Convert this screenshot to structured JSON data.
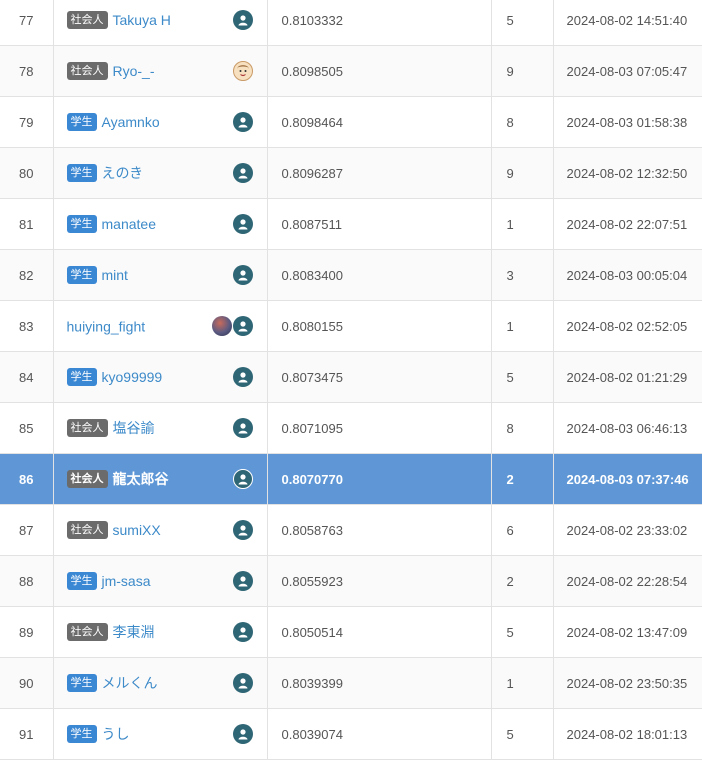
{
  "leaderboard": {
    "rows": [
      {
        "rank": "77",
        "badge": "社会人",
        "badge_color": "#6b6b6b",
        "name": "Takuya H",
        "avatars": [
          "default-user-icon"
        ],
        "score": "0.8103332",
        "submissions": "5",
        "date": "2024-08-02 14:51:40"
      },
      {
        "rank": "78",
        "badge": "社会人",
        "badge_color": "#6b6b6b",
        "name": "Ryo-_-",
        "avatars": [
          "cartoon-face-icon"
        ],
        "score": "0.8098505",
        "submissions": "9",
        "date": "2024-08-03 07:05:47"
      },
      {
        "rank": "79",
        "badge": "学生",
        "badge_color": "#3a87d4",
        "name": "Ayamnko",
        "avatars": [
          "default-user-icon"
        ],
        "score": "0.8098464",
        "submissions": "8",
        "date": "2024-08-03 01:58:38"
      },
      {
        "rank": "80",
        "badge": "学生",
        "badge_color": "#3a87d4",
        "name": "えのき",
        "avatars": [
          "default-user-icon"
        ],
        "score": "0.8096287",
        "submissions": "9",
        "date": "2024-08-02 12:32:50"
      },
      {
        "rank": "81",
        "badge": "学生",
        "badge_color": "#3a87d4",
        "name": "manatee",
        "avatars": [
          "default-user-icon"
        ],
        "score": "0.8087511",
        "submissions": "1",
        "date": "2024-08-02 22:07:51"
      },
      {
        "rank": "82",
        "badge": "学生",
        "badge_color": "#3a87d4",
        "name": "mint",
        "avatars": [
          "default-user-icon"
        ],
        "score": "0.8083400",
        "submissions": "3",
        "date": "2024-08-03 00:05:04"
      },
      {
        "rank": "83",
        "badge": "",
        "badge_color": "",
        "name": "huiying_fight",
        "avatars": [
          "photo-avatar-icon",
          "default-user-icon"
        ],
        "score": "0.8080155",
        "submissions": "1",
        "date": "2024-08-02 02:52:05"
      },
      {
        "rank": "84",
        "badge": "学生",
        "badge_color": "#3a87d4",
        "name": "kyo99999",
        "avatars": [
          "default-user-icon"
        ],
        "score": "0.8073475",
        "submissions": "5",
        "date": "2024-08-02 01:21:29"
      },
      {
        "rank": "85",
        "badge": "社会人",
        "badge_color": "#6b6b6b",
        "name": "塩谷諭",
        "avatars": [
          "default-user-icon"
        ],
        "score": "0.8071095",
        "submissions": "8",
        "date": "2024-08-03 06:46:13"
      },
      {
        "rank": "86",
        "badge": "社会人",
        "badge_color": "#6b6b6b",
        "name": "龍太郎谷",
        "avatars": [
          "default-user-icon"
        ],
        "score": "0.8070770",
        "submissions": "2",
        "date": "2024-08-03 07:37:46",
        "highlighted": true
      },
      {
        "rank": "87",
        "badge": "社会人",
        "badge_color": "#6b6b6b",
        "name": "sumiXX",
        "avatars": [
          "default-user-icon"
        ],
        "score": "0.8058763",
        "submissions": "6",
        "date": "2024-08-02 23:33:02"
      },
      {
        "rank": "88",
        "badge": "学生",
        "badge_color": "#3a87d4",
        "name": "jm-sasa",
        "avatars": [
          "default-user-icon"
        ],
        "score": "0.8055923",
        "submissions": "2",
        "date": "2024-08-02 22:28:54"
      },
      {
        "rank": "89",
        "badge": "社会人",
        "badge_color": "#6b6b6b",
        "name": "李東淵",
        "avatars": [
          "default-user-icon"
        ],
        "score": "0.8050514",
        "submissions": "5",
        "date": "2024-08-02 13:47:09"
      },
      {
        "rank": "90",
        "badge": "学生",
        "badge_color": "#3a87d4",
        "name": "メルくん",
        "avatars": [
          "default-user-icon"
        ],
        "score": "0.8039399",
        "submissions": "1",
        "date": "2024-08-02 23:50:35"
      },
      {
        "rank": "91",
        "badge": "学生",
        "badge_color": "#3a87d4",
        "name": "うし",
        "avatars": [
          "default-user-icon"
        ],
        "score": "0.8039074",
        "submissions": "5",
        "date": "2024-08-02 18:01:13"
      }
    ]
  },
  "colors": {
    "highlight_row": "#5f97d6",
    "link": "#3d8ac9",
    "badge_student": "#3a87d4",
    "badge_worker": "#6b6b6b",
    "default_avatar": "#2f6675"
  }
}
